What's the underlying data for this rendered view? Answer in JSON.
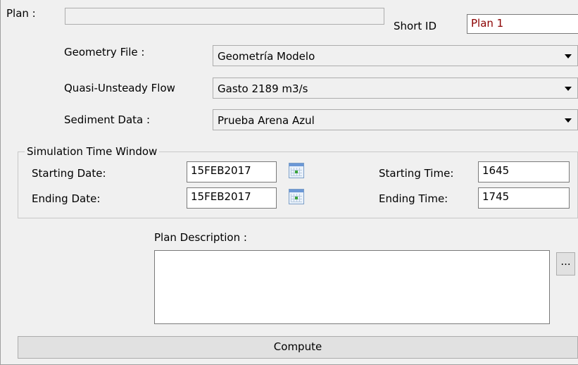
{
  "plan": {
    "label": "Plan :",
    "value": ""
  },
  "short_id": {
    "label": "Short ID",
    "value": "Plan 1"
  },
  "geometry": {
    "label": "Geometry File :",
    "selected": "Geometría Modelo"
  },
  "flow": {
    "label": "Quasi-Unsteady Flow",
    "selected": "Gasto 2189 m3/s"
  },
  "sediment": {
    "label": "Sediment Data :",
    "selected": "Prueba Arena Azul"
  },
  "time_window": {
    "title": "Simulation Time Window",
    "starting_date_label": "Starting Date:",
    "starting_date": "15FEB2017",
    "ending_date_label": "Ending Date:",
    "ending_date": "15FEB2017",
    "starting_time_label": "Starting Time:",
    "starting_time": "1645",
    "ending_time_label": "Ending Time:",
    "ending_time": "1745"
  },
  "description": {
    "label": "Plan Description :",
    "value": "",
    "button": "..."
  },
  "compute_label": "Compute",
  "icons": {
    "dropdown": "chevron-down-icon",
    "calendar": "calendar-icon"
  }
}
